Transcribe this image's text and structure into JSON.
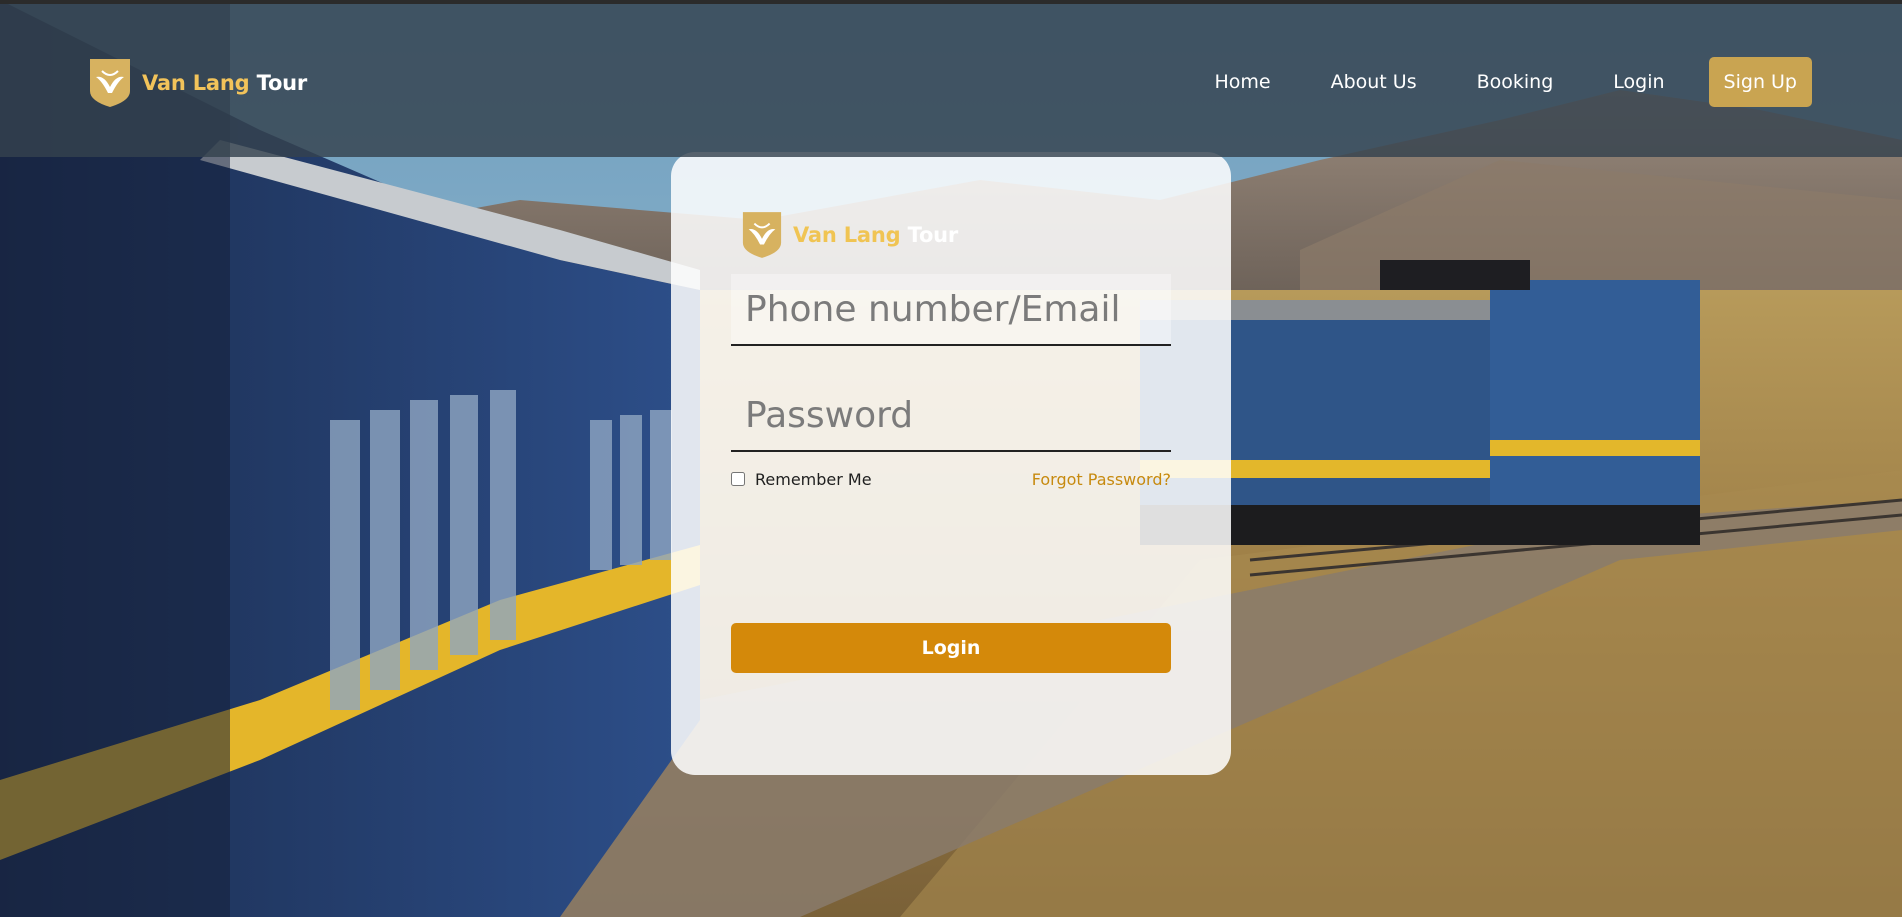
{
  "header": {
    "brand": {
      "word1": "Van Lang",
      "word2": "Tour",
      "logo_icon": "shield-bird-icon"
    },
    "nav": [
      {
        "label": "Home"
      },
      {
        "label": "About Us"
      },
      {
        "label": "Booking"
      },
      {
        "label": "Login"
      }
    ],
    "signup_label": "Sign Up"
  },
  "login_form": {
    "brand": {
      "word1": "Van Lang",
      "word2": "Tour"
    },
    "phone_placeholder": "Phone number/Email",
    "password_placeholder": "Password",
    "remember_label": "Remember Me",
    "forgot_label": "Forgot Password?",
    "submit_label": "Login"
  },
  "colors": {
    "brand_gold": "#f2c35a",
    "signup_bg": "#c9a451",
    "login_button": "#d4890a",
    "forgot_link": "#c78a0f",
    "header_overlay": "#34424e"
  }
}
